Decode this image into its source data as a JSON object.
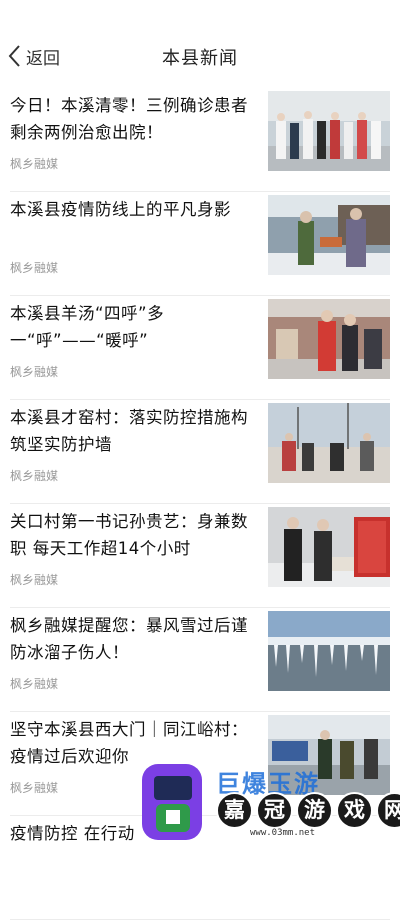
{
  "header": {
    "back_label": "返回",
    "title": "本县新闻"
  },
  "news": [
    {
      "title": "今日！本溪清零！三例确诊患者剩余两例治愈出院！",
      "source": "枫乡融媒",
      "image": "hospital-staff-photo"
    },
    {
      "title": "本溪县疫情防线上的平凡身影",
      "source": "枫乡融媒",
      "image": "checkpoint-volunteers-photo"
    },
    {
      "title": "本溪县羊汤“四呼”多一“呼”——“暖呼”",
      "source": "枫乡融媒",
      "image": "soup-delivery-photo"
    },
    {
      "title": "本溪县才窑村：落实防控措施构筑坚实防护墙",
      "source": "枫乡融媒",
      "image": "village-checkpoint-photo"
    },
    {
      "title": "关口村第一书记孙贵艺：身兼数职 每天工作超14个小时",
      "source": "枫乡融媒",
      "image": "inspection-station-photo"
    },
    {
      "title": "枫乡融媒提醒您：暴风雪过后谨防冰溜子伤人！",
      "source": "枫乡融媒",
      "image": "icicles-roof-photo"
    },
    {
      "title": "坚守本溪县西大门｜同江峪村：疫情过后欢迎你",
      "source": "枫乡融媒",
      "image": "road-checkpoint-photo"
    },
    {
      "title": "疫情防控 在行动",
      "source": "",
      "image": ""
    }
  ],
  "watermark": {
    "brand_top": "巨爆玉游",
    "chars": [
      "嘉",
      "冠",
      "游",
      "戏",
      "网"
    ],
    "url": "www.03mm.net"
  },
  "colors": {
    "background": "#ffffff",
    "divider": "#ececec",
    "source_text": "#9a9a9a",
    "watermark_blue": "#1e6fd9"
  }
}
